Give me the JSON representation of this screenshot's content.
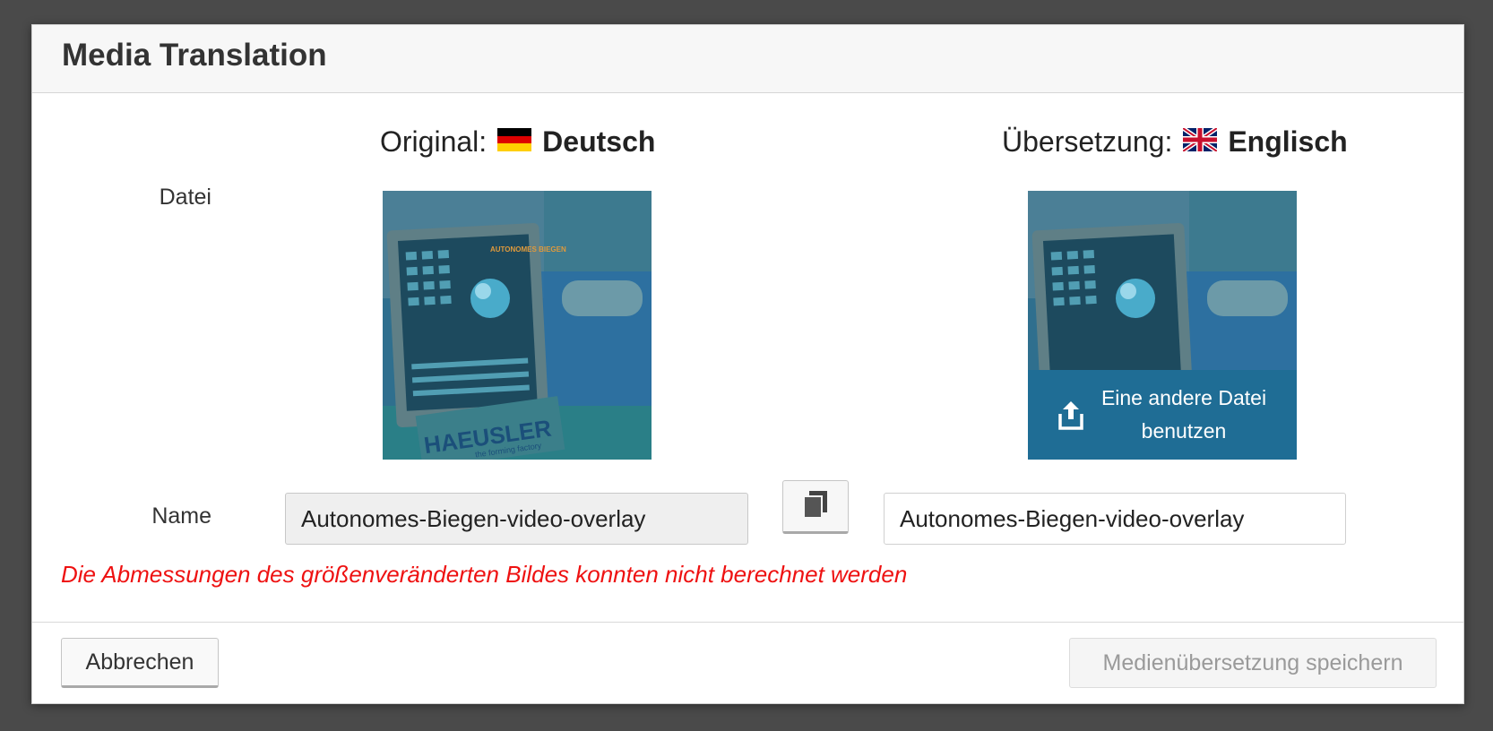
{
  "dialog": {
    "title": "Media Translation"
  },
  "original": {
    "prefix": "Original:",
    "language": "Deutsch",
    "flag": "de-flag-icon",
    "name_value": "Autonomes-Biegen-video-overlay"
  },
  "translation": {
    "prefix": "Übersetzung:",
    "language": "Englisch",
    "flag": "uk-flag-icon",
    "name_value": "Autonomes-Biegen-video-overlay",
    "upload_label_line1": "Eine andere Datei",
    "upload_label_line2": "benutzen"
  },
  "labels": {
    "file": "Datei",
    "name": "Name"
  },
  "thumbnail": {
    "brand_text": "HAEUSLER",
    "brand_tagline": "the forming factory",
    "screen_text": "AUTONOMES BIEGEN"
  },
  "error_message": "Die Abmessungen des größenveränderten Bildes konnten nicht berechnet werden",
  "buttons": {
    "cancel": "Abbrechen",
    "save": "Medienübersetzung speichern"
  },
  "colors": {
    "accent": "#1f6d95",
    "error": "#ee1111",
    "backdrop": "#4a4a4a"
  }
}
